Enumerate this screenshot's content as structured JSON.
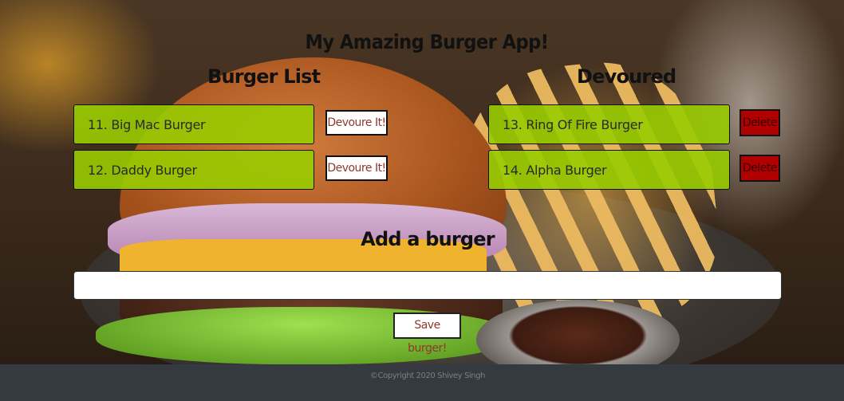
{
  "app": {
    "title": "My Amazing Burger App!"
  },
  "burger_list": {
    "title": "Burger List",
    "items": [
      {
        "label": "11. Big Mac Burger",
        "button": "Devoure It!"
      },
      {
        "label": "12. Daddy Burger",
        "button": "Devoure It!"
      }
    ]
  },
  "devoured": {
    "title": "Devoured",
    "items": [
      {
        "label": "13. Ring Of Fire Burger",
        "button": "Delete"
      },
      {
        "label": "14. Alpha Burger",
        "button": "Delete"
      }
    ]
  },
  "add_burger": {
    "title": "Add a burger",
    "input_value": "",
    "input_placeholder": "",
    "save_label": "Save burger!"
  },
  "footer": {
    "copyright": "©Copyright 2020 Shivey Singh"
  },
  "colors": {
    "item_green": "#98cc00",
    "delete_red": "#b00000",
    "footer_bg": "#343a40"
  }
}
